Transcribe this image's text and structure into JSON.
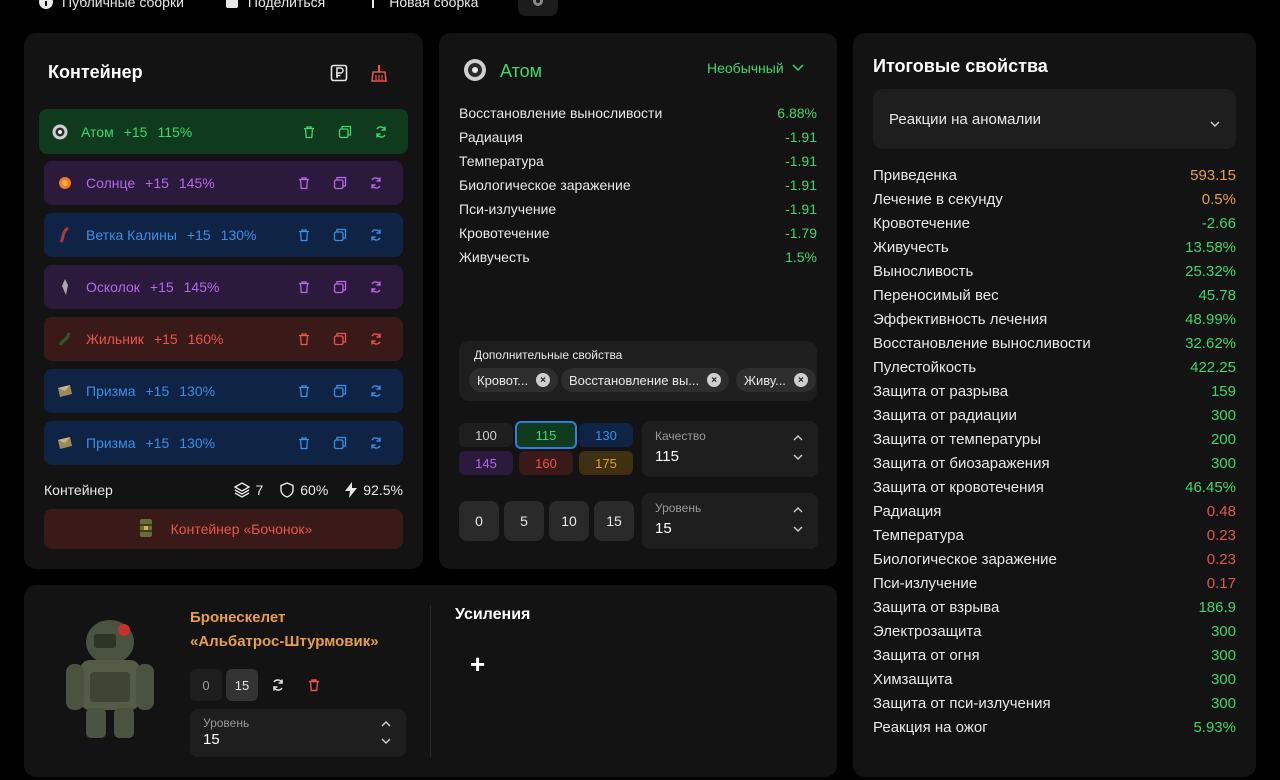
{
  "topnav": {
    "public_label": "Публичные сборки",
    "share_label": "Поделиться",
    "new_label": "Новая сборка"
  },
  "container": {
    "title": "Контейнер",
    "artifacts": [
      {
        "name": "Атом",
        "plus": "+15",
        "quality": "115%",
        "color": "green",
        "icon": "atom-icon"
      },
      {
        "name": "Солнце",
        "plus": "+15",
        "quality": "145%",
        "color": "purple",
        "icon": "sun-icon"
      },
      {
        "name": "Ветка Калины",
        "plus": "+15",
        "quality": "130%",
        "color": "blue",
        "icon": "viburnum-branch-icon"
      },
      {
        "name": "Осколок",
        "plus": "+15",
        "quality": "145%",
        "color": "purple",
        "icon": "shard-icon"
      },
      {
        "name": "Жильник",
        "plus": "+15",
        "quality": "160%",
        "color": "red",
        "icon": "vein-icon"
      },
      {
        "name": "Призма",
        "plus": "+15",
        "quality": "130%",
        "color": "blue",
        "icon": "prism-icon"
      },
      {
        "name": "Призма",
        "plus": "+15",
        "quality": "130%",
        "color": "blue",
        "icon": "prism-icon"
      }
    ],
    "footer": {
      "label": "Контейнер",
      "slots": "7",
      "protection": "60%",
      "efficiency": "92.5%"
    },
    "barrel_label": "Контейнер «Бочонок»"
  },
  "artifact_detail": {
    "name": "Атом",
    "rarity": "Необычный",
    "properties": [
      {
        "name": "Восстановление выносливости",
        "value": "6.88%"
      },
      {
        "name": "Радиация",
        "value": "-1.91"
      },
      {
        "name": "Температура",
        "value": "-1.91"
      },
      {
        "name": "Биологическое заражение",
        "value": "-1.91"
      },
      {
        "name": "Пси-излучение",
        "value": "-1.91"
      },
      {
        "name": "Кровотечение",
        "value": "-1.79"
      },
      {
        "name": "Живучесть",
        "value": "1.5%"
      }
    ],
    "extra_title": "Дополнительные свойства",
    "extra_chips": [
      "Кровот...",
      "Восстановление вы...",
      "Живу..."
    ],
    "quality_options": [
      "100",
      "115",
      "130",
      "145",
      "160",
      "175"
    ],
    "quality_selected": "115",
    "quality_label": "Качество",
    "quality_value": "115",
    "level_buttons": [
      "0",
      "5",
      "10",
      "15"
    ],
    "level_label": "Уровень",
    "level_value": "15"
  },
  "totals": {
    "title": "Итоговые свойства",
    "filter": "Реакции на аномалии",
    "rows": [
      {
        "name": "Приведенка",
        "value": "593.15",
        "tone": "orange"
      },
      {
        "name": "Лечение в секунду",
        "value": "0.5%",
        "tone": "orange"
      },
      {
        "name": "Кровотечение",
        "value": "-2.66",
        "tone": "green"
      },
      {
        "name": "Живучесть",
        "value": "13.58%",
        "tone": "green"
      },
      {
        "name": "Выносливость",
        "value": "25.32%",
        "tone": "green"
      },
      {
        "name": "Переносимый вес",
        "value": "45.78",
        "tone": "green"
      },
      {
        "name": "Эффективность лечения",
        "value": "48.99%",
        "tone": "green"
      },
      {
        "name": "Восстановление выносливости",
        "value": "32.62%",
        "tone": "green"
      },
      {
        "name": "Пулестойкость",
        "value": "422.25",
        "tone": "green"
      },
      {
        "name": "Защита от разрыва",
        "value": "159",
        "tone": "green"
      },
      {
        "name": "Защита от радиации",
        "value": "300",
        "tone": "green"
      },
      {
        "name": "Защита от температуры",
        "value": "200",
        "tone": "green"
      },
      {
        "name": "Защита от биозаражения",
        "value": "300",
        "tone": "green"
      },
      {
        "name": "Защита от кровотечения",
        "value": "46.45%",
        "tone": "green"
      },
      {
        "name": "Радиация",
        "value": "0.48",
        "tone": "red"
      },
      {
        "name": "Температура",
        "value": "0.23",
        "tone": "red"
      },
      {
        "name": "Биологическое заражение",
        "value": "0.23",
        "tone": "red"
      },
      {
        "name": "Пси-излучение",
        "value": "0.17",
        "tone": "red"
      },
      {
        "name": "Защита от взрыва",
        "value": "186.9",
        "tone": "green"
      },
      {
        "name": "Электрозащита",
        "value": "300",
        "tone": "green"
      },
      {
        "name": "Защита от огня",
        "value": "300",
        "tone": "green"
      },
      {
        "name": "Химзащита",
        "value": "300",
        "tone": "green"
      },
      {
        "name": "Защита от пси-излучения",
        "value": "300",
        "tone": "green"
      },
      {
        "name": "Реакция на ожог",
        "value": "5.93%",
        "tone": "green"
      }
    ]
  },
  "armor": {
    "name_line1": "Бронескелет",
    "name_line2": "«Альбатрос-Штурмовик»",
    "level_buttons": [
      "0",
      "15"
    ],
    "level_label": "Уровень",
    "level_value": "15",
    "upgrades_title": "Усиления",
    "add_label": "+"
  }
}
